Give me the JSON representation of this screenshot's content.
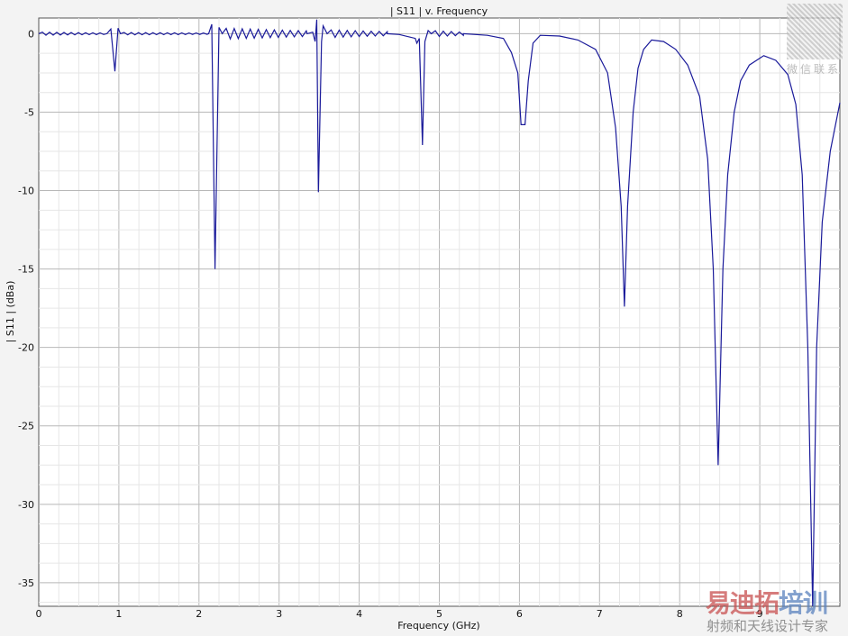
{
  "chart_data": {
    "type": "line",
    "title": "| S11 | v. Frequency",
    "xlabel": "Frequency (GHz)",
    "ylabel": "| S11 | (dBa)",
    "xlim": [
      0,
      10
    ],
    "ylim": [
      -36.5,
      1
    ],
    "xticks": [
      "0",
      "1",
      "2",
      "3",
      "4",
      "5",
      "6",
      "7",
      "8",
      "9"
    ],
    "yticks": [
      "0",
      "-5",
      "-10",
      "-15",
      "-20",
      "-25",
      "-30",
      "-35"
    ],
    "grid": true,
    "line_color": "#1a1a9a",
    "ripples": [
      {
        "from": 0,
        "to": 0.85,
        "amp": 0.1,
        "period": 0.09
      },
      {
        "from": 1.02,
        "to": 2.12,
        "amp": 0.08,
        "period": 0.09
      },
      {
        "from": 2.29,
        "to": 3.35,
        "amp": 0.35,
        "period": 0.1
      },
      {
        "from": 3.6,
        "to": 4.35,
        "amp": 0.25,
        "period": 0.1
      },
      {
        "from": 4.9,
        "to": 5.3,
        "amp": 0.2,
        "period": 0.1
      }
    ],
    "points": [
      [
        0,
        0
      ],
      [
        0.85,
        0
      ],
      [
        0.9,
        0.3
      ],
      [
        0.95,
        -2.4
      ],
      [
        0.99,
        0.35
      ],
      [
        1.02,
        0
      ],
      [
        2.12,
        0
      ],
      [
        2.16,
        0.6
      ],
      [
        2.2,
        -15
      ],
      [
        2.25,
        0.4
      ],
      [
        2.29,
        0
      ],
      [
        3.35,
        0
      ],
      [
        3.42,
        0.1
      ],
      [
        3.45,
        -0.5
      ],
      [
        3.47,
        0.9
      ],
      [
        3.49,
        -10.1
      ],
      [
        3.53,
        -0.5
      ],
      [
        3.55,
        0.5
      ],
      [
        3.6,
        0
      ],
      [
        4.35,
        0
      ],
      [
        4.5,
        -0.05
      ],
      [
        4.7,
        -0.3
      ],
      [
        4.72,
        -0.6
      ],
      [
        4.75,
        -0.3
      ],
      [
        4.79,
        -7.1
      ],
      [
        4.82,
        -0.5
      ],
      [
        4.86,
        0.2
      ],
      [
        4.9,
        0
      ],
      [
        5.3,
        0
      ],
      [
        5.6,
        -0.1
      ],
      [
        5.8,
        -0.3
      ],
      [
        5.9,
        -1.2
      ],
      [
        5.98,
        -2.5
      ],
      [
        6.02,
        -5.8
      ],
      [
        6.07,
        -5.8
      ],
      [
        6.11,
        -3
      ],
      [
        6.17,
        -0.6
      ],
      [
        6.26,
        -0.1
      ],
      [
        6.5,
        -0.15
      ],
      [
        6.73,
        -0.4
      ],
      [
        6.95,
        -1
      ],
      [
        7.1,
        -2.5
      ],
      [
        7.2,
        -6
      ],
      [
        7.27,
        -11
      ],
      [
        7.31,
        -17.4
      ],
      [
        7.35,
        -11
      ],
      [
        7.42,
        -5
      ],
      [
        7.48,
        -2.2
      ],
      [
        7.55,
        -1
      ],
      [
        7.65,
        -0.4
      ],
      [
        7.8,
        -0.5
      ],
      [
        7.95,
        -1
      ],
      [
        8.1,
        -2
      ],
      [
        8.25,
        -4
      ],
      [
        8.35,
        -8
      ],
      [
        8.42,
        -15
      ],
      [
        8.48,
        -27.5
      ],
      [
        8.54,
        -15
      ],
      [
        8.6,
        -9
      ],
      [
        8.68,
        -5
      ],
      [
        8.76,
        -3
      ],
      [
        8.87,
        -2
      ],
      [
        9.05,
        -1.4
      ],
      [
        9.2,
        -1.7
      ],
      [
        9.35,
        -2.6
      ],
      [
        9.45,
        -4.5
      ],
      [
        9.53,
        -9
      ],
      [
        9.6,
        -20
      ],
      [
        9.66,
        -36.5
      ],
      [
        9.71,
        -20
      ],
      [
        9.78,
        -12
      ],
      [
        9.88,
        -7.5
      ],
      [
        10,
        -4.4
      ]
    ]
  },
  "watermark": {
    "brand_a": "易迪拓",
    "brand_b": "培训",
    "tagline": "射频和天线设计专家",
    "qr_label": "微信联系"
  }
}
